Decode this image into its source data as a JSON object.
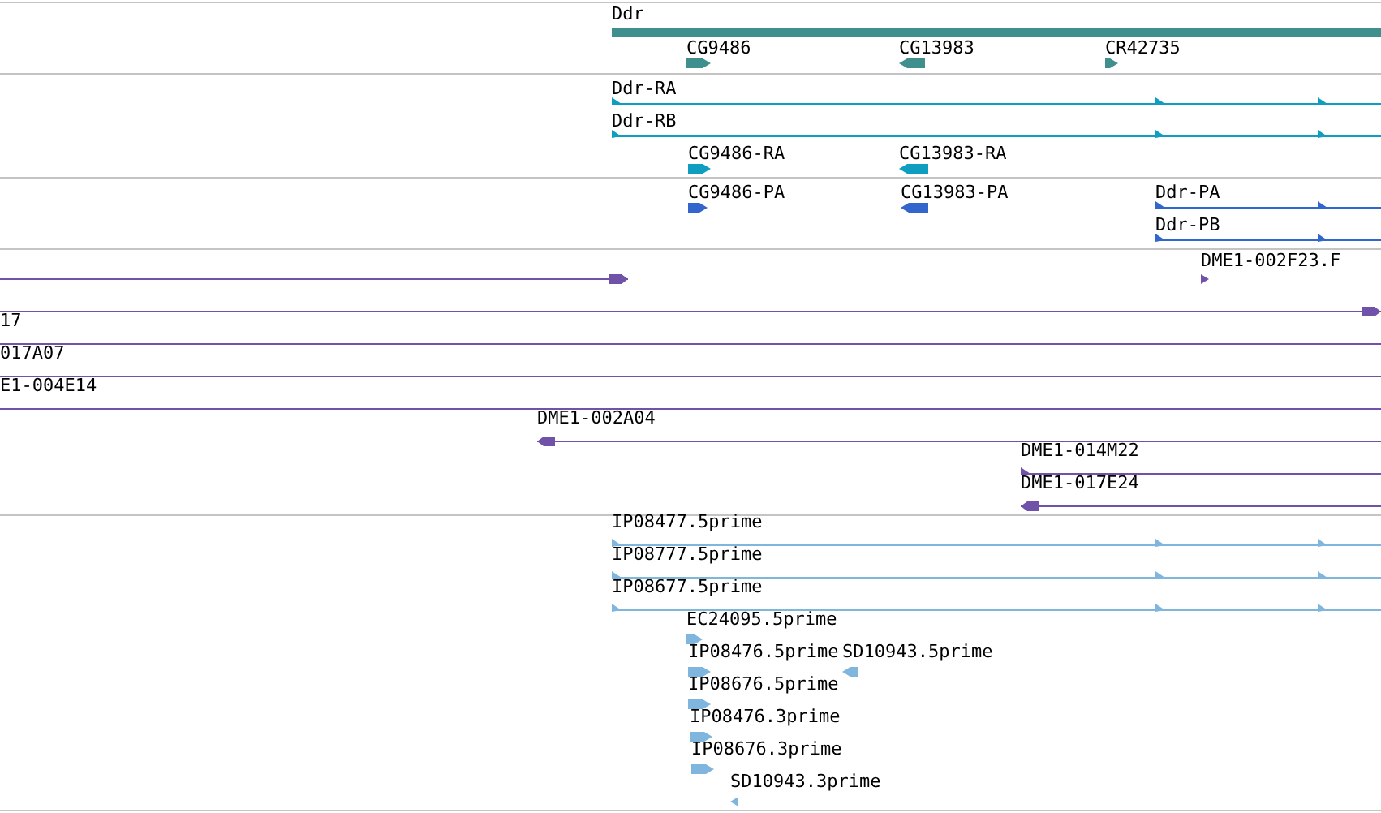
{
  "tracks": [
    {
      "color": "#3f8f8f",
      "features": [
        {
          "label": "Ddr",
          "kind": "bar"
        },
        {
          "label": "CG9486",
          "kind": "small",
          "arrow": true,
          "reverse": false
        },
        {
          "label": "CG13983",
          "kind": "small",
          "arrow": true,
          "reverse": true
        },
        {
          "label": "CR42735",
          "kind": "small",
          "arrow": true,
          "reverse": false
        }
      ]
    },
    {
      "color": "#0f9dc0",
      "features": [
        {
          "label": "Ddr-RA",
          "kind": "transcript",
          "arrow": true,
          "reverse": false
        },
        {
          "label": "Ddr-RB",
          "kind": "transcript",
          "arrow": true,
          "reverse": false
        },
        {
          "label": "CG9486-RA",
          "kind": "small",
          "arrow": true,
          "reverse": false
        },
        {
          "label": "CG13983-RA",
          "kind": "small",
          "arrow": true,
          "reverse": true
        }
      ]
    },
    {
      "color": "#3366cc",
      "features": [
        {
          "label": "CG9486-PA",
          "kind": "small",
          "arrow": true,
          "reverse": false
        },
        {
          "label": "CG13983-PA",
          "kind": "small",
          "arrow": true,
          "reverse": true
        },
        {
          "label": "Ddr-PA",
          "kind": "transcript",
          "arrow": true,
          "reverse": false
        },
        {
          "label": "Ddr-PB",
          "kind": "transcript",
          "arrow": true,
          "reverse": false
        }
      ]
    },
    {
      "color": "#7052a8",
      "features": [
        {
          "kind": "clone",
          "arrow": true,
          "reverse": false
        },
        {
          "label": "DME1-002F23.F",
          "kind": "small",
          "arrow": true,
          "reverse": false
        },
        {
          "kind": "clone",
          "arrow": true,
          "reverse": false
        },
        {
          "label": "17",
          "kind": "clone",
          "arrow": false
        },
        {
          "label": "017A07",
          "kind": "clone",
          "arrow": false
        },
        {
          "label": "E1-004E14",
          "kind": "clone",
          "arrow": false
        },
        {
          "label": "DME1-002A04",
          "kind": "clone",
          "arrow": true,
          "reverse": true
        },
        {
          "label": "DME1-014M22",
          "kind": "transcript",
          "arrow": true,
          "reverse": false
        },
        {
          "label": "DME1-017E24",
          "kind": "clone",
          "arrow": true,
          "reverse": true
        }
      ]
    },
    {
      "color": "#80b6de",
      "features": [
        {
          "label": "IP08477.5prime",
          "kind": "transcript",
          "arrow": true,
          "reverse": false
        },
        {
          "label": "IP08777.5prime",
          "kind": "transcript",
          "arrow": true,
          "reverse": false
        },
        {
          "label": "IP08677.5prime",
          "kind": "transcript",
          "arrow": true,
          "reverse": false
        },
        {
          "label": "EC24095.5prime",
          "kind": "small",
          "arrow": true,
          "reverse": false
        },
        {
          "label": "IP08476.5prime",
          "kind": "small",
          "arrow": true,
          "reverse": false
        },
        {
          "label": "SD10943.5prime",
          "kind": "small",
          "arrow": true,
          "reverse": true
        },
        {
          "label": "IP08676.5prime",
          "kind": "small",
          "arrow": true,
          "reverse": false
        },
        {
          "label": "IP08476.3prime",
          "kind": "small",
          "arrow": true,
          "reverse": false
        },
        {
          "label": "IP08676.3prime",
          "kind": "small",
          "arrow": true,
          "reverse": false
        },
        {
          "label": "SD10943.3prime",
          "kind": "small",
          "arrow": true,
          "reverse": true
        }
      ]
    }
  ]
}
